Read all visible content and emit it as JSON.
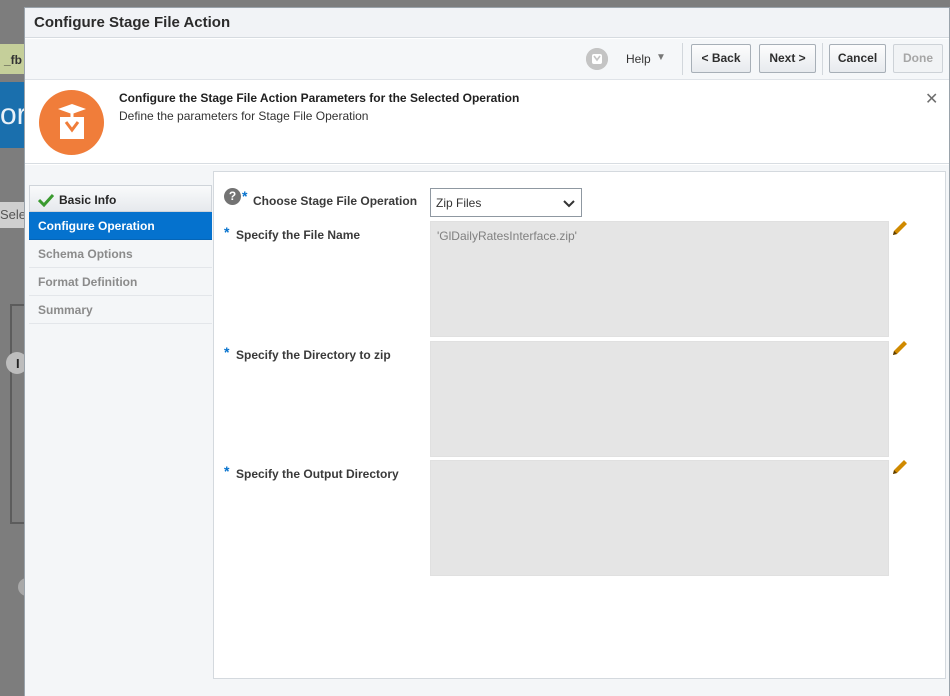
{
  "background": {
    "tab_text": "_fb",
    "banner_text": "ort",
    "select_text": "Sele",
    "marker_text": "I"
  },
  "dialog": {
    "title": "Configure Stage File Action"
  },
  "toolbar": {
    "help_icon": "help-circle-icon",
    "help_label": "Help",
    "back_label": "< Back",
    "next_label": "Next >",
    "cancel_label": "Cancel",
    "done_label": "Done"
  },
  "header": {
    "icon": "stage-file-icon",
    "title": "Configure the Stage File Action Parameters for the Selected Operation",
    "subtitle": "Define the parameters for Stage File Operation",
    "close_glyph": "✕"
  },
  "nav": {
    "items": [
      {
        "label": "Basic Info",
        "state": "done"
      },
      {
        "label": "Configure Operation",
        "state": "active"
      },
      {
        "label": "Schema Options",
        "state": "disabled"
      },
      {
        "label": "Format Definition",
        "state": "disabled"
      },
      {
        "label": "Summary",
        "state": "disabled"
      }
    ]
  },
  "form": {
    "operation_label": "Choose Stage File Operation",
    "operation_value": "Zip Files",
    "file_name_label": "Specify the File Name",
    "file_name_value": "'GlDailyRatesInterface.zip'",
    "directory_label": "Specify the Directory to zip",
    "directory_value": "",
    "output_label": "Specify the Output Directory",
    "output_value": "",
    "required_marker": "*",
    "help_glyph": "?"
  },
  "colors": {
    "accent": "#0572ce",
    "header_icon": "#f07d3a",
    "field_bg": "#e5e5e5",
    "pencil": "#d08a00"
  }
}
